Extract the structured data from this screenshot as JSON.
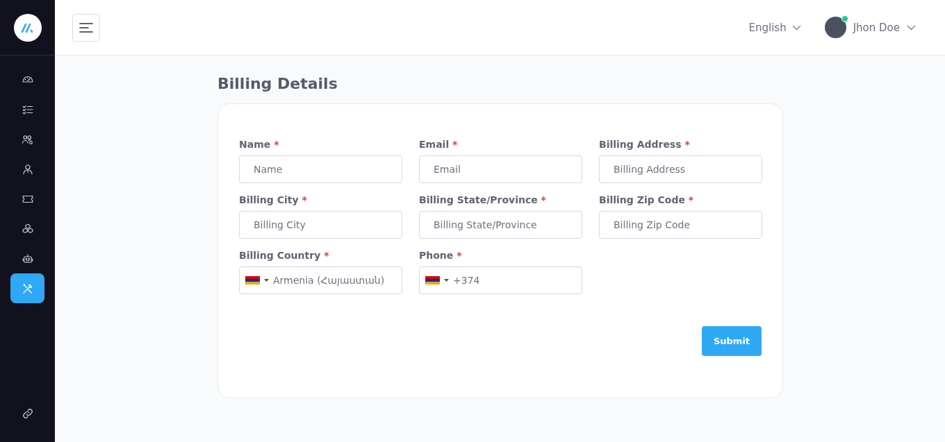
{
  "sidebar": {
    "items": [
      {
        "selected": false
      },
      {
        "selected": false
      },
      {
        "selected": false
      },
      {
        "selected": false
      },
      {
        "selected": false
      },
      {
        "selected": false
      },
      {
        "selected": false
      },
      {
        "selected": true
      }
    ]
  },
  "header": {
    "language": "English",
    "user": {
      "name": "Jhon Doe",
      "online": true
    }
  },
  "page_title": "Billing Details",
  "form": {
    "fields": [
      {
        "kind": "text",
        "label": "Name",
        "required_mark": "*",
        "placeholder": "Name"
      },
      {
        "kind": "text",
        "label": "Email",
        "required_mark": "*",
        "placeholder": "Email"
      },
      {
        "kind": "text",
        "label": "Billing Address",
        "required_mark": "*",
        "placeholder": "Billing Address"
      },
      {
        "kind": "text",
        "label": "Billing City",
        "required_mark": "*",
        "placeholder": "Billing City"
      },
      {
        "kind": "text",
        "label": "Billing State/Province",
        "required_mark": "*",
        "placeholder": "Billing State/Province"
      },
      {
        "kind": "text",
        "label": "Billing Zip Code",
        "required_mark": "*",
        "placeholder": "Billing Zip Code"
      },
      {
        "kind": "country",
        "label": "Billing Country",
        "required_mark": "*",
        "value": "Armenia (Հայաստան)"
      },
      {
        "kind": "phone",
        "label": "Phone",
        "required_mark": "*",
        "value": "+374"
      }
    ],
    "submit": "Submit"
  }
}
